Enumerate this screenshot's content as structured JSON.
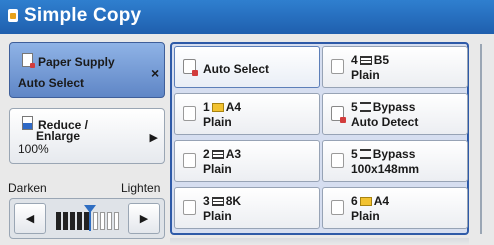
{
  "window": {
    "title": "Simple Copy",
    "accent": "#1f5fae"
  },
  "left": {
    "paper_supply": {
      "label": "Paper Supply",
      "value": "Auto Select",
      "close": "×"
    },
    "reduce": {
      "label_1": "Reduce /",
      "label_2": "Enlarge",
      "value": "100%",
      "arrow": "▶"
    },
    "density": {
      "dark": "Darken",
      "light": "Lighten",
      "left": "◀",
      "right": "▶",
      "level_fraction": 0.5
    }
  },
  "trays": [
    {
      "id": "auto",
      "l1": "Auto Select",
      "l2": ""
    },
    {
      "id": "t4",
      "l1_pre": "4",
      "icon": "lines",
      "l1_post": "B5",
      "l2": "Plain"
    },
    {
      "id": "t1",
      "l1_pre": "1",
      "icon": "yellow",
      "l1_post": "A4",
      "l2": "Plain"
    },
    {
      "id": "bp1",
      "l1_pre": "5",
      "icon": "bypass",
      "l1_post": "Bypass",
      "l2": "Auto Detect"
    },
    {
      "id": "t2",
      "l1_pre": "2",
      "icon": "lines",
      "l1_post": "A3",
      "l2": "Plain"
    },
    {
      "id": "bp2",
      "l1_pre": "5",
      "icon": "bypass",
      "l1_post": "Bypass",
      "l2": "100x148mm"
    },
    {
      "id": "t3",
      "l1_pre": "3",
      "icon": "lines",
      "l1_post": "8K",
      "l2": "Plain"
    },
    {
      "id": "t6",
      "l1_pre": "6",
      "icon": "yellow",
      "l1_post": "A4",
      "l2": "Plain"
    }
  ]
}
